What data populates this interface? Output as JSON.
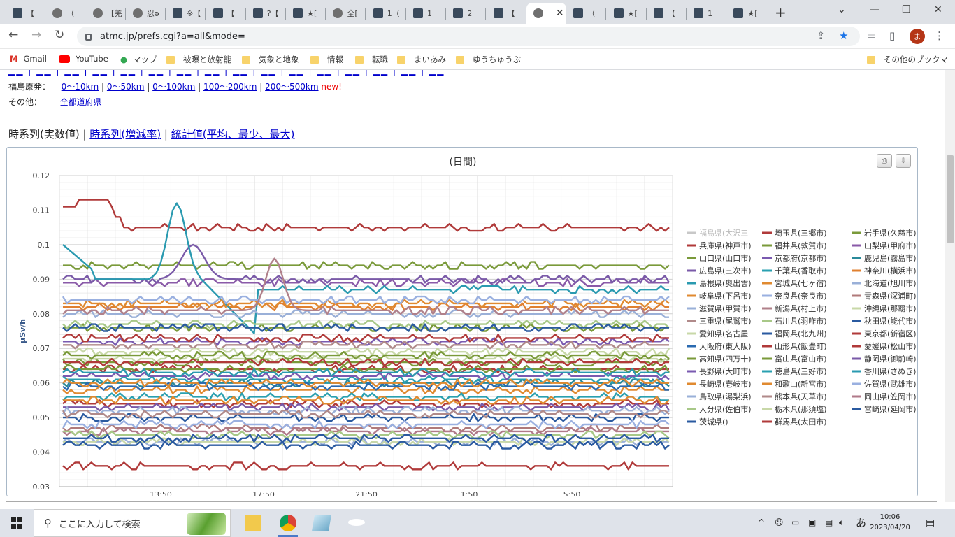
{
  "browser": {
    "tabs": [
      {
        "title": "【",
        "icon": "site-icon"
      },
      {
        "title": "（ ",
        "icon": "globe-icon"
      },
      {
        "title": "【羌",
        "icon": "globe-icon"
      },
      {
        "title": "忍ǝ",
        "icon": "globe-icon"
      },
      {
        "title": "※【",
        "icon": "site-icon"
      },
      {
        "title": "【",
        "icon": "site-icon"
      },
      {
        "title": "?【",
        "icon": "site-icon"
      },
      {
        "title": "★[",
        "icon": "site-icon"
      },
      {
        "title": "全[",
        "icon": "globe-icon"
      },
      {
        "title": "1（",
        "icon": "site-icon"
      },
      {
        "title": "1 ",
        "icon": "site-icon"
      },
      {
        "title": "2 ",
        "icon": "site-icon"
      },
      {
        "title": "【",
        "icon": "site-icon"
      },
      {
        "title": "",
        "icon": "globe-icon",
        "active": true
      },
      {
        "title": "（ ",
        "icon": "site-icon"
      },
      {
        "title": "★[",
        "icon": "site-icon"
      },
      {
        "title": "【",
        "icon": "site-icon"
      },
      {
        "title": "1 ",
        "icon": "site-icon"
      },
      {
        "title": "★[",
        "icon": "site-icon"
      }
    ],
    "url": "atmc.jp/prefs.cgi?a=all&mode=",
    "profile_initial": "ま",
    "bookmarks": [
      {
        "label": "Gmail",
        "icon": "gmail-icon"
      },
      {
        "label": "YouTube",
        "icon": "youtube-icon"
      },
      {
        "label": "マップ",
        "icon": "maps-icon"
      },
      {
        "label": "被曝と放射能",
        "icon": "folder-icon"
      },
      {
        "label": "気象と地象",
        "icon": "folder-icon"
      },
      {
        "label": "情報",
        "icon": "folder-icon"
      },
      {
        "label": "転職",
        "icon": "folder-icon"
      },
      {
        "label": "まいあみ",
        "icon": "folder-icon"
      },
      {
        "label": "ゆうちゅうぶ",
        "icon": "folder-icon"
      }
    ],
    "other_bookmarks": "その他のブックマーク"
  },
  "page": {
    "fukushima": {
      "label": "福島原発：",
      "links": [
        "0～10km",
        "0～50km",
        "0～100km",
        "100～200km",
        "200～500km"
      ],
      "new": "new!"
    },
    "other": {
      "label": "その他：",
      "link": "全都道府県"
    },
    "modes": {
      "current": "時系列(実数値)",
      "link1": "時系列(増減率)",
      "link2": "統計値(平均、最少、最大)",
      "sep": "|"
    }
  },
  "chart_data": {
    "type": "line",
    "title": "(日間)",
    "ylabel": "μSv/h",
    "ylim": [
      0.03,
      0.12
    ],
    "yticks": [
      "0.12",
      "0.11",
      "0.1",
      "0.09",
      "0.08",
      "0.07",
      "0.06",
      "0.05",
      "0.04",
      "0.03"
    ],
    "xticks": [
      "13:50",
      "17:50",
      "21:50",
      "1:50",
      "5:50"
    ],
    "grid": true,
    "legend_position": "right",
    "series": [
      {
        "name": "福島県(大沢三",
        "color": "#c8c8c8",
        "base": null
      },
      {
        "name": "埼玉県(三郷市)",
        "color": "#b03a3a",
        "base": 0.064
      },
      {
        "name": "岩手県(久慈市)",
        "color": "#7a9a3a",
        "base": 0.066
      },
      {
        "name": "兵庫県(神戸市)",
        "color": "#b03a3a",
        "base": 0.105
      },
      {
        "name": "福井県(敦賀市)",
        "color": "#7a9a3a",
        "base": 0.076
      },
      {
        "name": "山梨県(甲府市)",
        "color": "#8a5aa8",
        "base": 0.089
      },
      {
        "name": "山口県(山口市)",
        "color": "#7a9a3a",
        "base": 0.094
      },
      {
        "name": "京都府(京都市)",
        "color": "#7a5ab0",
        "base": 0.072
      },
      {
        "name": "鹿児島(霧島市)",
        "color": "#2a8a9a",
        "base": 0.06
      },
      {
        "name": "広島県(三次市)",
        "color": "#7a5aa8",
        "base": 0.09
      },
      {
        "name": "千葉県(香取市)",
        "color": "#2aa0b0",
        "base": 0.061
      },
      {
        "name": "神奈川(横浜市)",
        "color": "#e08030",
        "base": 0.082
      },
      {
        "name": "島根県(奥出雲)",
        "color": "#2a9ab0",
        "base": 0.087
      },
      {
        "name": "宮城県(七ヶ宿)",
        "color": "#e08a30",
        "base": 0.058
      },
      {
        "name": "北海道(旭川市)",
        "color": "#9ab0d8",
        "base": 0.043
      },
      {
        "name": "岐阜県(下呂市)",
        "color": "#e08a30",
        "base": 0.083
      },
      {
        "name": "奈良県(奈良市)",
        "color": "#9ab0e0",
        "base": 0.084
      },
      {
        "name": "青森県(深浦町)",
        "color": "#b07a7a",
        "base": 0.047
      },
      {
        "name": "滋賀県(甲賀市)",
        "color": "#9ab0d8",
        "base": 0.08
      },
      {
        "name": "新潟県(村上市)",
        "color": "#b0808a",
        "base": 0.081
      },
      {
        "name": "沖縄県(那覇市)",
        "color": "#c8d8a8",
        "base": 0.067
      },
      {
        "name": "三重県(尾鷲市)",
        "color": "#b08a8a",
        "base": 0.071
      },
      {
        "name": "石川県(羽咋市)",
        "color": "#a8c888",
        "base": 0.077
      },
      {
        "name": "秋田県(能代市)",
        "color": "#2a5aa0",
        "base": 0.05
      },
      {
        "name": "愛知県(名古屋",
        "color": "#c8d8a8",
        "base": 0.069
      },
      {
        "name": "福岡県(北九州)",
        "color": "#2a5aa0",
        "base": 0.076
      },
      {
        "name": "東京都(新宿区)",
        "color": "#b03a3a",
        "base": 0.073
      },
      {
        "name": "大阪府(東大阪)",
        "color": "#2a6ab0",
        "base": 0.059
      },
      {
        "name": "山形県(飯豊町)",
        "color": "#b03a3a",
        "base": 0.054
      },
      {
        "name": "愛媛県(松山市)",
        "color": "#b03a3a",
        "base": 0.066
      },
      {
        "name": "高知県(四万十)",
        "color": "#7a9a3a",
        "base": 0.068
      },
      {
        "name": "富山県(富山市)",
        "color": "#7a9a3a",
        "base": 0.064
      },
      {
        "name": "静岡県(御前崎)",
        "color": "#7a5aa8",
        "base": 0.053
      },
      {
        "name": "長野県(大町市)",
        "color": "#7a5ab0",
        "base": 0.062
      },
      {
        "name": "徳島県(三好市)",
        "color": "#2aa0b0",
        "base": 0.056
      },
      {
        "name": "香川県(さぬき)",
        "color": "#2a9ab0",
        "base": 0.063
      },
      {
        "name": "長崎県(壱岐市)",
        "color": "#e08a30",
        "base": 0.055
      },
      {
        "name": "和歌山(新宮市)",
        "color": "#e08a30",
        "base": 0.06
      },
      {
        "name": "佐賀県(武雄市)",
        "color": "#9ab0e0",
        "base": 0.048
      },
      {
        "name": "鳥取県(湯梨浜)",
        "color": "#9ab0d8",
        "base": 0.052
      },
      {
        "name": "熊本県(天草市)",
        "color": "#b08a8a",
        "base": 0.051
      },
      {
        "name": "岡山県(笠岡市)",
        "color": "#b07a8a",
        "base": 0.046
      },
      {
        "name": "大分県(佐伯市)",
        "color": "#a8c888",
        "base": 0.045
      },
      {
        "name": "栃木県(那須塩)",
        "color": "#c8d8a8",
        "base": 0.043
      },
      {
        "name": "宮崎県(延岡市)",
        "color": "#2a5aa0",
        "base": 0.042
      },
      {
        "name": "茨城県()",
        "color": "#2a5aa0",
        "base": 0.044
      },
      {
        "name": "群馬県(太田市)",
        "color": "#b03a3a",
        "base": 0.036
      }
    ]
  },
  "taskbar": {
    "search_placeholder": "ここに入力して検索",
    "time": "10:06",
    "date": "2023/04/20",
    "ime": "あ"
  }
}
